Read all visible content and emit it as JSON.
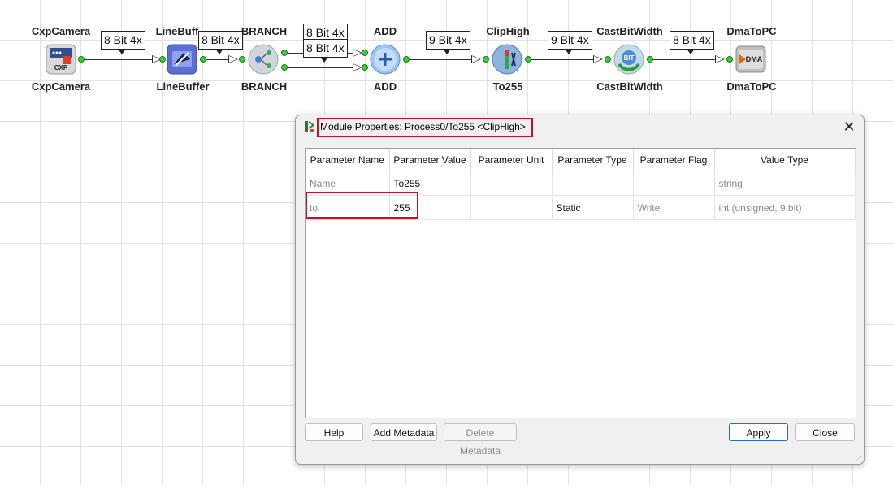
{
  "pipeline": {
    "modules": [
      {
        "top_label": "CxpCamera",
        "bottom_label": "CxpCamera",
        "icon": "cxp-camera-icon"
      },
      {
        "top_label": "LineBuff",
        "bottom_label": "LineBuffer",
        "icon": "line-buffer-icon"
      },
      {
        "top_label": "BRANCH",
        "bottom_label": "BRANCH",
        "icon": "branch-icon"
      },
      {
        "top_label": "ADD",
        "bottom_label": "ADD",
        "icon": "add-icon"
      },
      {
        "top_label": "ClipHigh",
        "bottom_label": "To255",
        "icon": "clip-high-icon"
      },
      {
        "top_label": "CastBitWidth",
        "bottom_label": "CastBitWidth",
        "icon": "cast-bit-width-icon"
      },
      {
        "top_label": "DmaToPC",
        "bottom_label": "DmaToPC",
        "icon": "dma-icon"
      }
    ],
    "links": [
      "8 Bit 4x",
      "8 Bit 4x",
      "8 Bit 4x",
      "8 Bit 4x",
      "9 Bit 4x",
      "9 Bit 4x",
      "8 Bit 4x"
    ],
    "cxp_icon_text": "CXP",
    "bit_icon_text": "BIT",
    "dma_icon_text": "DMA"
  },
  "dialog": {
    "title": "Module Properties: Process0/To255 <ClipHigh>",
    "close_label": "✕",
    "columns": [
      "Parameter Name",
      "Parameter Value",
      "Parameter Unit",
      "Parameter Type",
      "Parameter Flag",
      "Value Type"
    ],
    "rows": [
      [
        "Name",
        "To255",
        "",
        "",
        "",
        "string"
      ],
      [
        "to",
        "255",
        "",
        "Static",
        "Write",
        "int (unsigned, 9 bit)"
      ]
    ],
    "buttons": {
      "help": "Help",
      "add_metadata": "Add Metadata",
      "delete_metadata": "Delete Metadata",
      "apply": "Apply",
      "close": "Close"
    },
    "highlight_color": "#c8102e"
  }
}
